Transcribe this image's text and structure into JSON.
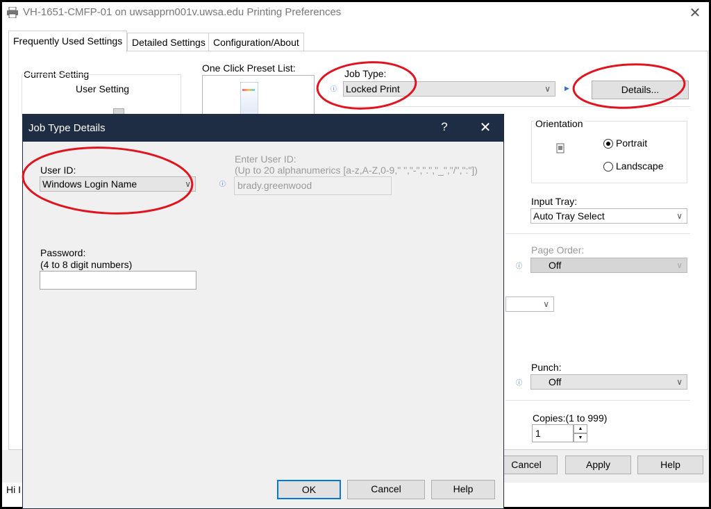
{
  "window": {
    "title": "VH-1651-CMFP-01 on uwsapprn001v.uwsa.edu Printing Preferences",
    "close_glyph": "✕"
  },
  "tabs": [
    {
      "label": "Frequently Used Settings",
      "active": true
    },
    {
      "label": "Detailed Settings",
      "active": false
    },
    {
      "label": "Configuration/About",
      "active": false
    }
  ],
  "panel": {
    "current_setting_label": "Current Setting",
    "user_setting_label": "User Setting",
    "preset_list_label": "One Click Preset List:",
    "job_type_label": "Job Type:",
    "job_type_value": "Locked Print",
    "details_button": "Details...",
    "orientation_label": "Orientation",
    "portrait_label": "Portrait",
    "landscape_label": "Landscape",
    "orientation_selected": "Portrait",
    "input_tray_label": "Input Tray:",
    "input_tray_value": "Auto Tray Select",
    "page_order_label": "Page Order:",
    "page_order_value": "Off",
    "punch_label": "Punch:",
    "punch_value": "Off",
    "copies_label": "Copies:(1 to 999)",
    "copies_value": "1"
  },
  "footer": {
    "cancel_button": "Cancel",
    "apply_button": "Apply",
    "help_button": "Help",
    "partial_text": "Hi I"
  },
  "dialog": {
    "title": "Job Type Details",
    "help_glyph": "?",
    "close_glyph": "✕",
    "user_id_label": "User ID:",
    "user_id_value": "Windows Login Name",
    "enter_user_id_label": "Enter User ID:",
    "enter_user_id_hint": "(Up to 20 alphanumerics [a-z,A-Z,0-9,\" \",\"-\",\".\",\"_\",\"/\",\":\"])",
    "enter_user_id_value": "brady.greenwood",
    "password_label": "Password:",
    "password_hint": "(4 to 8 digit numbers)",
    "password_value": "",
    "ok_button": "OK",
    "cancel_button": "Cancel",
    "help_button": "Help"
  },
  "colors": {
    "dialog_title_bg": "#1f2d44",
    "annotation_red": "#e0141e",
    "info_icon": "#3a6fd8"
  }
}
